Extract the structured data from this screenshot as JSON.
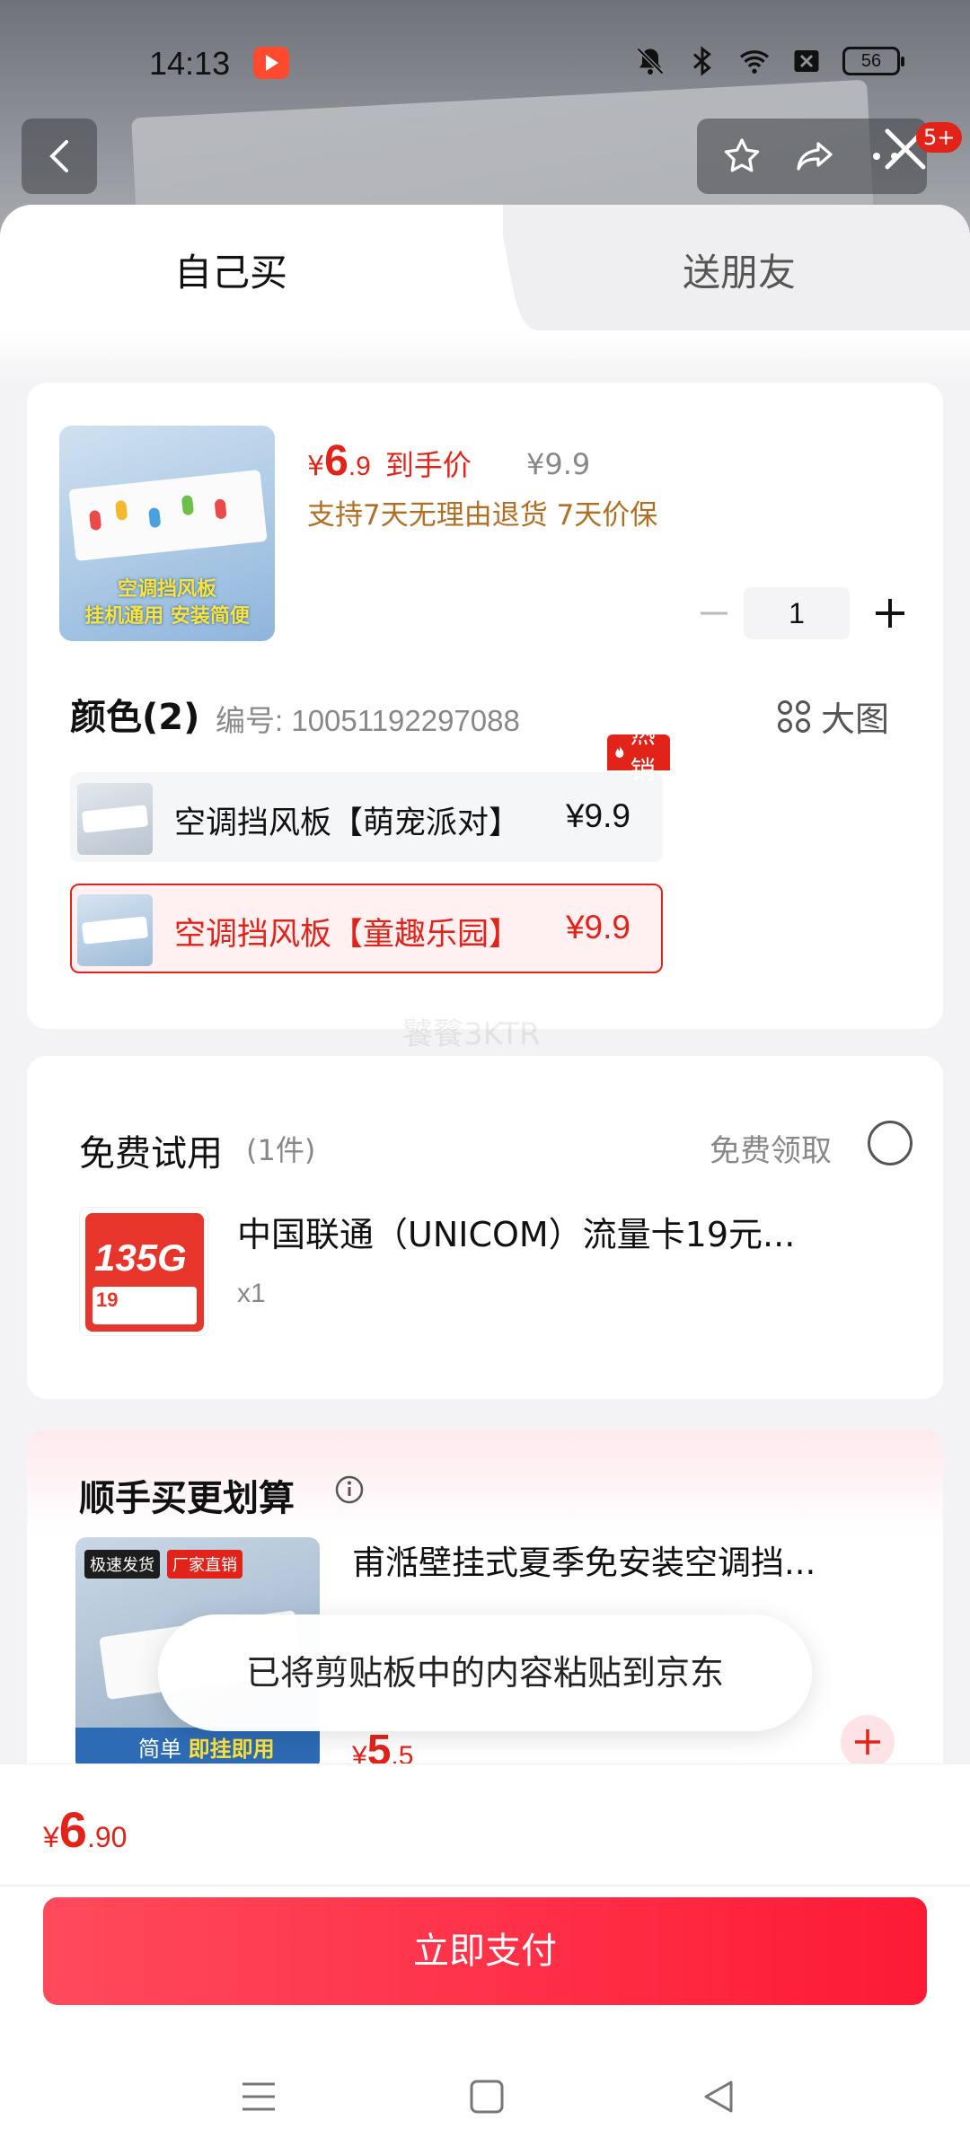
{
  "status_bar": {
    "time": "14:13",
    "battery": "56"
  },
  "header": {
    "notification_badge": "5+"
  },
  "tabs": [
    {
      "label": "自己买",
      "active": true
    },
    {
      "label": "送朋友",
      "active": false
    }
  ],
  "product": {
    "price_yen": "¥",
    "price_int": "6",
    "price_dec": ".9",
    "price_tag": "到手价",
    "original_price": "¥9.9",
    "support_text": "支持7天无理由退货  7天价保",
    "image_caption_line1": "空调挡风板",
    "image_caption_line2": "挂机通用 安装简便",
    "quantity": "1",
    "color_title": "颜色(2)",
    "sku_number": "编号: 10051192297088",
    "big_image_label": "大图",
    "options": [
      {
        "label": "空调挡风板【萌宠派对】",
        "price": "¥9.9",
        "hot_tag": "热销",
        "selected": false
      },
      {
        "label": "空调挡风板【童趣乐园】",
        "price": "¥9.9",
        "selected": true
      }
    ],
    "watermark": "饕餮3KTR"
  },
  "free_trial": {
    "title": "免费试用",
    "count": "(1件)",
    "get_label": "免费领取",
    "item_name": "中国联通（UNICOM）流量卡19元...",
    "item_qty": "x1",
    "image_text_big": "135G",
    "image_text_price": "19"
  },
  "upsell": {
    "title": "顺手买更划算",
    "item_name": "甫湉壁挂式夏季免安装空调挡...",
    "price_yen": "¥",
    "price_int": "5",
    "price_dec": ".5",
    "image_tag_1": "极速发货",
    "image_tag_2": "厂家直销",
    "image_caption_a": "简单 ",
    "image_caption_b": "即挂即用"
  },
  "toast": "已将剪贴板中的内容粘贴到京东",
  "footer": {
    "total_yen": "¥",
    "total_int": "6",
    "total_dec": ".90",
    "pay_label": "立即支付"
  },
  "colors": {
    "accent": "#e2231a",
    "pay_button": "#fd1a36",
    "support_text": "#b06f24"
  }
}
